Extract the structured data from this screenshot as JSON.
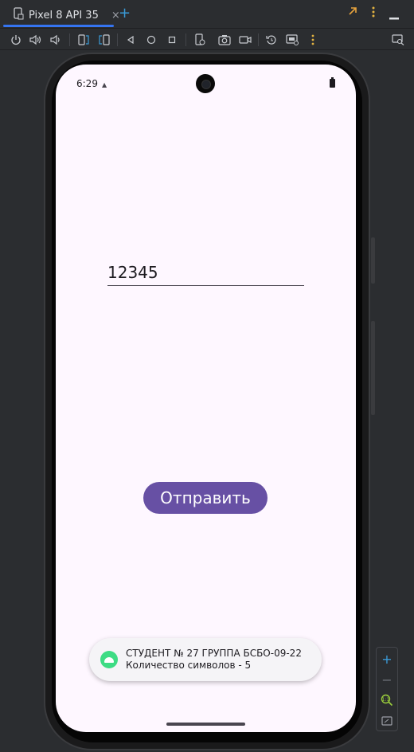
{
  "tab": {
    "title": "Pixel 8 API 35",
    "close": "×",
    "add": "+"
  },
  "phone": {
    "status_time": "6:29",
    "input_value": "12345",
    "button_label": "Отправить",
    "toast_line1": "СТУДЕНТ № 27 ГРУППА БСБО-09-22",
    "toast_line2": "Количество символов - 5"
  },
  "zoom": {
    "plus": "+",
    "minus": "−"
  },
  "colors": {
    "accent": "#3574f0",
    "button": "#6750a4",
    "screen_bg": "#fef7ff",
    "android_green": "#3ddc84"
  },
  "icons": [
    "device-tab-icon",
    "power-icon",
    "volume-up-icon",
    "volume-down-icon",
    "rotate-left-icon",
    "rotate-right-icon",
    "back-icon",
    "home-icon",
    "overview-icon",
    "fold-icon",
    "screenshot-icon",
    "record-icon",
    "reset-icon",
    "snapshot-icon",
    "more-icon",
    "expand-icon",
    "minimize-icon",
    "layout-inspector-icon",
    "zoom-fit-icon",
    "zoom-actual-icon"
  ]
}
